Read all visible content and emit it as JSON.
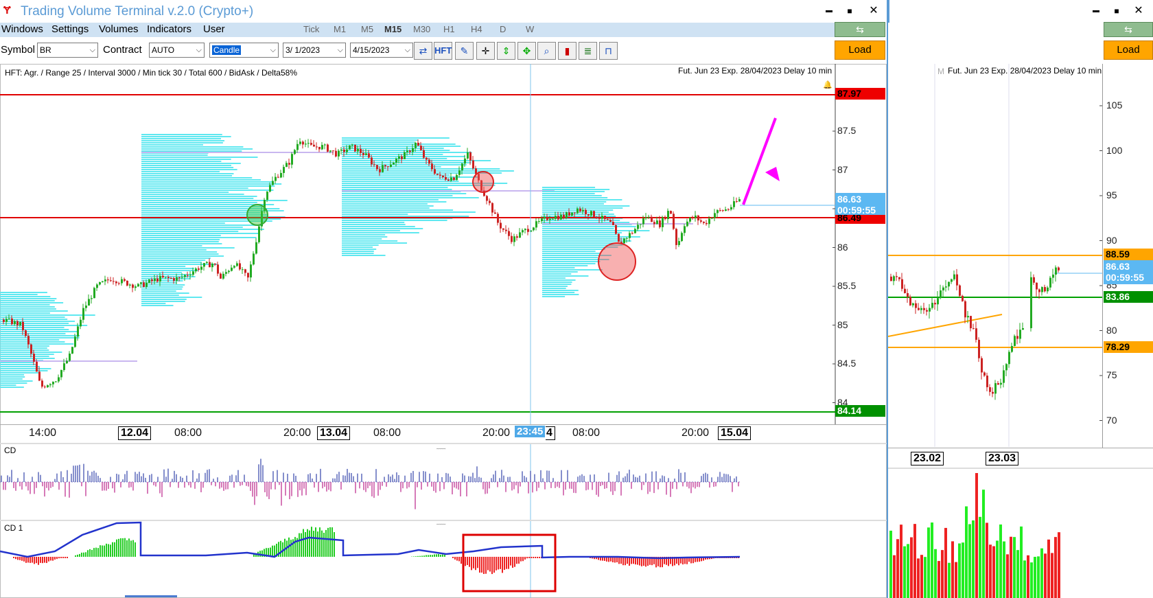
{
  "window": {
    "title": "Trading Volume Terminal v.2.0 (Crypto+)",
    "minimize": "▬",
    "maximize": "■",
    "close": "✕"
  },
  "menu": [
    "Windows",
    "Settings",
    "Volumes",
    "Indicators",
    "User"
  ],
  "timeframes": [
    "Tick",
    "M1",
    "M5",
    "M15",
    "M30",
    "H1",
    "H4",
    "D",
    "W"
  ],
  "active_timeframe": "M15",
  "toolbar": {
    "symbol_label": "Symbol",
    "symbol_value": "BR",
    "contract_label": "Contract",
    "contract_value": "AUTO",
    "chart_type": "Candle",
    "date_from": "3/ 1/2023",
    "date_to": "4/15/2023",
    "hft_label": "HFT",
    "load_label": "Load"
  },
  "main_chart": {
    "info_text": "HFT: Agr. / Range 25 / Interval 3000 / Min tick 30 / Total 600 / BidAsk / Delta58%",
    "contract_text": "Fut. Jun 23 Exp. 28/04/2023 Delay 10 min",
    "price_ticks": [
      "87.5",
      "87",
      "86.5",
      "86",
      "85.5",
      "85",
      "84.5",
      "84"
    ],
    "tag_top": "87.97",
    "tag_current_price": "86.63",
    "tag_current_timer": "00:59:55",
    "tag_mid": "86.49",
    "tag_bottom": "84.14",
    "time_labels": [
      "14:00",
      "08:00",
      "20:00",
      "08:00",
      "20:00",
      "08:00",
      "20:00"
    ],
    "date_labels": [
      "12.04",
      "13.04",
      "15.04"
    ],
    "cursor_time": "23:45",
    "cursor_suffix": "4",
    "cd_label": "CD",
    "cd1_label": "CD 1"
  },
  "side_chart": {
    "contract_text": "Fut. Jun 23 Exp. 28/04/2023 Delay 10 min",
    "m_label": "M",
    "price_ticks": [
      "105",
      "100",
      "95",
      "90",
      "85",
      "80",
      "75",
      "70"
    ],
    "tag_upper": "88.59",
    "tag_current_price": "86.63",
    "tag_current_timer": "00:59:55",
    "tag_green": "83.86",
    "tag_lower": "78.29",
    "date_labels": [
      "23.02",
      "23.03"
    ]
  },
  "colors": {
    "menu_bg": "#cfe2f3",
    "load_btn": "#ffa500",
    "profile": "#5fe8f0",
    "red_line": "#e00000",
    "green_line": "#00a000",
    "orange_line": "#ffa500",
    "candle_up": "#22aa22",
    "candle_down": "#cc2222",
    "arrow": "#ff00ff",
    "cd_line": "#2233cc"
  }
}
